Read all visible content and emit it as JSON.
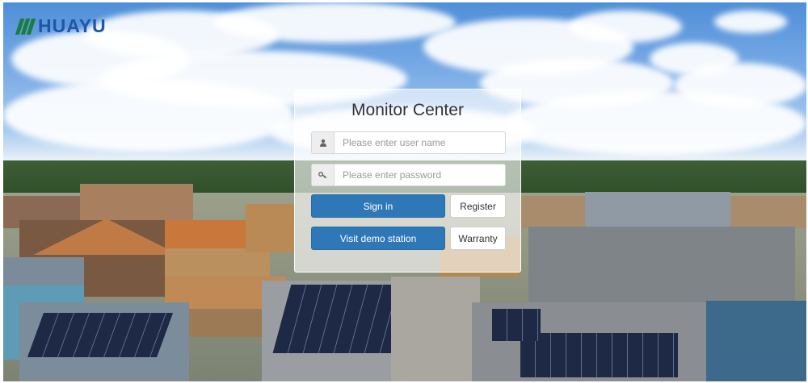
{
  "brand": {
    "name": "HUAYU"
  },
  "login": {
    "title": "Monitor Center",
    "username_placeholder": "Please enter user name",
    "password_placeholder": "Please enter password",
    "sign_in_label": "Sign in",
    "register_label": "Register",
    "demo_label": "Visit demo station",
    "warranty_label": "Warranty"
  },
  "icons": {
    "username": "user-icon",
    "password": "key-icon"
  },
  "colors": {
    "primary_button": "#2f78b8",
    "logo_text": "#1f56a6",
    "logo_mark": "#1a7d3b"
  }
}
